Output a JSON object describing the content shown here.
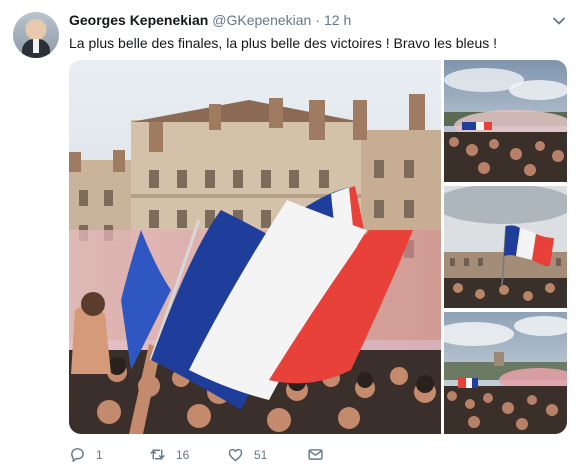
{
  "tweet": {
    "author_name": "Georges Kepenekian",
    "handle": "@GKepenekian",
    "separator": "·",
    "time": "12 h",
    "text": "La plus belle des finales, la plus belle des victoires ! Bravo les bleus !",
    "actions": {
      "reply_count": "1",
      "retweet_count": "16",
      "like_count": "51"
    }
  },
  "colors": {
    "text": "#14171a",
    "muted": "#657786",
    "flag_blue": "#1f3d9a",
    "flag_red": "#e8413a"
  },
  "icons": [
    "caret-down-icon",
    "reply-icon",
    "retweet-icon",
    "like-icon",
    "direct-message-icon"
  ]
}
